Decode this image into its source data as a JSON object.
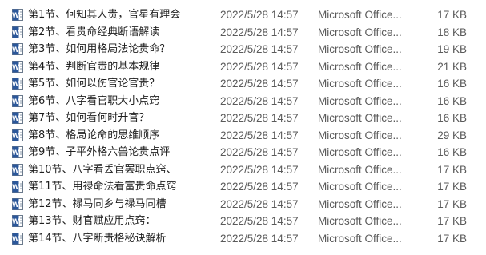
{
  "files": [
    {
      "name": "第1节、何知其人贵，官星有理会",
      "modified": "2022/5/28 14:57",
      "type": "Microsoft Office...",
      "size": "17 KB",
      "icon": "word-document-icon"
    },
    {
      "name": "第2节、看贵命经典断语解读",
      "modified": "2022/5/28 14:57",
      "type": "Microsoft Office...",
      "size": "18 KB",
      "icon": "word-document-icon"
    },
    {
      "name": "第3节、如何用格局法论贵命？",
      "modified": "2022/5/28 14:57",
      "type": "Microsoft Office...",
      "size": "19 KB",
      "icon": "word-document-icon"
    },
    {
      "name": "第4节、判断官贵的基本规律",
      "modified": "2022/5/28 14:57",
      "type": "Microsoft Office...",
      "size": "21 KB",
      "icon": "word-document-icon"
    },
    {
      "name": "第5节、如何以伤官论官贵？",
      "modified": "2022/5/28 14:57",
      "type": "Microsoft Office...",
      "size": "16 KB",
      "icon": "word-document-icon"
    },
    {
      "name": "第6节、八字看官职大小点窍",
      "modified": "2022/5/28 14:57",
      "type": "Microsoft Office...",
      "size": "16 KB",
      "icon": "word-document-icon"
    },
    {
      "name": "第7节、如何看何时升官？",
      "modified": "2022/5/28 14:57",
      "type": "Microsoft Office...",
      "size": "16 KB",
      "icon": "word-document-icon"
    },
    {
      "name": "第8节、格局论命的思维顺序",
      "modified": "2022/5/28 14:57",
      "type": "Microsoft Office...",
      "size": "29 KB",
      "icon": "word-document-icon"
    },
    {
      "name": "第9节、子平外格六兽论贵点评",
      "modified": "2022/5/28 14:57",
      "type": "Microsoft Office...",
      "size": "16 KB",
      "icon": "word-document-icon"
    },
    {
      "name": "第10节、八字看丢官罢职点窍、",
      "modified": "2022/5/28 14:57",
      "type": "Microsoft Office...",
      "size": "17 KB",
      "icon": "word-document-icon"
    },
    {
      "name": "第11节、用禄命法看富贵命点窍",
      "modified": "2022/5/28 14:57",
      "type": "Microsoft Office...",
      "size": "17 KB",
      "icon": "word-document-icon"
    },
    {
      "name": "第12节、禄马同乡与禄马同槽",
      "modified": "2022/5/28 14:57",
      "type": "Microsoft Office...",
      "size": "17 KB",
      "icon": "word-document-icon"
    },
    {
      "name": "第13节、财官赋应用点窍：",
      "modified": "2022/5/28 14:57",
      "type": "Microsoft Office...",
      "size": "17 KB",
      "icon": "word-document-icon"
    },
    {
      "name": "第14节、八字断贵格秘诀解析",
      "modified": "2022/5/28 14:57",
      "type": "Microsoft Office...",
      "size": "17 KB",
      "icon": "word-document-icon"
    }
  ]
}
